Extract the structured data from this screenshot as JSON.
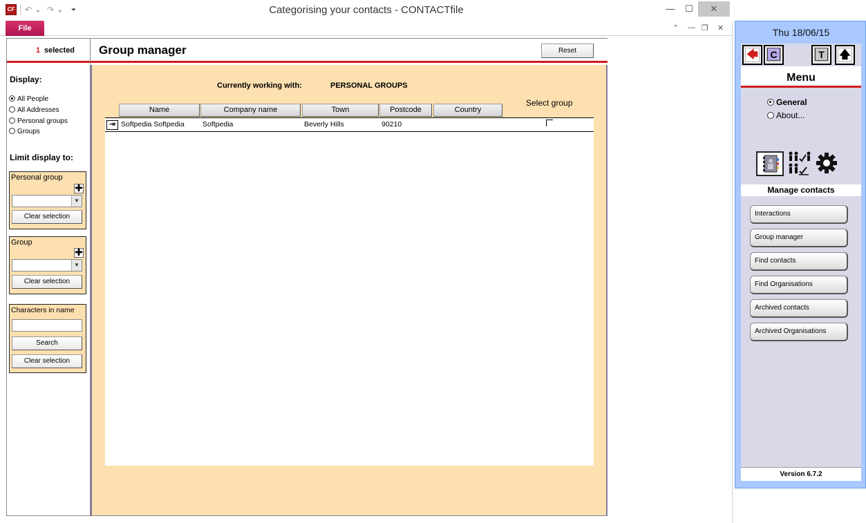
{
  "window": {
    "title": "Categorising your contacts  -  CONTACTfile",
    "app_icon": "CF",
    "undo_glyph": "↶",
    "redo_glyph": "↷",
    "dropdown_glyph": "▾",
    "customize_glyph": "⏷",
    "minimize_glyph": "—",
    "maximize_glyph": "☐",
    "close_glyph": "✕"
  },
  "ribbon": {
    "file_tab": "File",
    "up_glyph": "⌃",
    "restore_glyph": "❐",
    "close_glyph": "✕"
  },
  "selection": {
    "count": "1",
    "label": "selected"
  },
  "left_panel": {
    "display_heading": "Display:",
    "display_options": [
      {
        "label": "All People",
        "selected": true
      },
      {
        "label": "All Addresses",
        "selected": false
      },
      {
        "label": "Personal groups",
        "selected": false
      },
      {
        "label": "Groups",
        "selected": false
      }
    ],
    "limit_heading": "Limit display to:",
    "personal_group": {
      "title": "Personal group",
      "plus": "✚",
      "clear_label": "Clear selection"
    },
    "group": {
      "title": "Group",
      "plus": "✚",
      "clear_label": "Clear selection"
    },
    "characters": {
      "title": "Characters in name",
      "search_label": "Search",
      "clear_label": "Clear selection"
    }
  },
  "content": {
    "title": "Group manager",
    "reset_label": "Reset",
    "working_label": "Currently working with:",
    "working_value": "PERSONAL GROUPS",
    "select_group_label": "Select group",
    "columns": [
      "Name",
      "Company name",
      "Town",
      "Postcode",
      "Country"
    ],
    "rows": [
      {
        "name": "Softpedia Softpedia",
        "company": "Softpedia",
        "town": "Beverly Hills",
        "postcode": "90210",
        "country": "",
        "selected": false
      }
    ]
  },
  "menu": {
    "date": "Thu 18/06/15",
    "nav": {
      "back": "🡄",
      "c": "C",
      "t": "T",
      "up": "🡅"
    },
    "title": "Menu",
    "options": [
      {
        "label": "General",
        "selected": true
      },
      {
        "label": "About...",
        "selected": false
      }
    ],
    "section_label": "Manage contacts",
    "buttons": [
      "Interactions",
      "Group manager",
      "Find contacts",
      "Find Organisations",
      "Archived contacts",
      "Archived Organisations"
    ],
    "version": "Version 6.7.2"
  },
  "colors": {
    "accent_red": "#d21b1b",
    "file_tab": "#c2185b",
    "panel_orange": "#fde0b0",
    "menu_blue": "#a8c8ff",
    "menu_grey": "#d8d8e8"
  }
}
